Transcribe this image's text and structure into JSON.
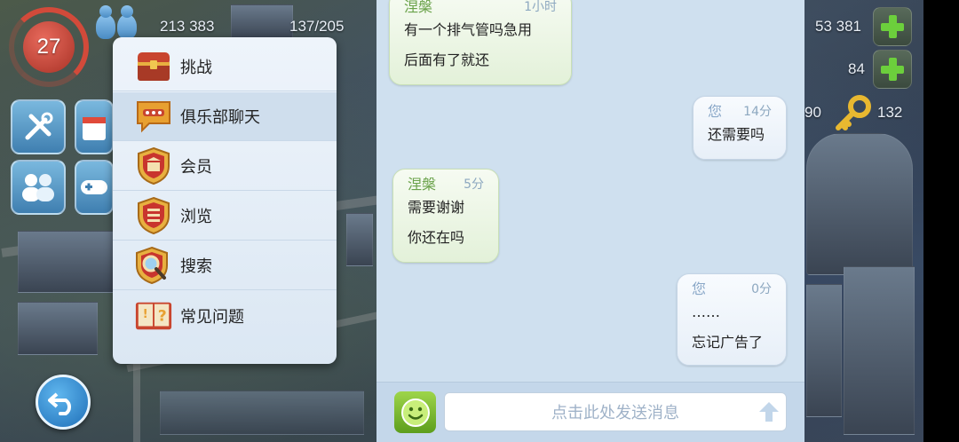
{
  "hud": {
    "level": "27",
    "population": "213 383",
    "capacity": "137/205",
    "simoleons": "53 381",
    "simcash": "84",
    "partial_value": "90",
    "keys": "132"
  },
  "menu": {
    "items": [
      {
        "label": "挑战",
        "icon": "treasure-chest-icon"
      },
      {
        "label": "俱乐部聊天",
        "icon": "chat-bubble-icon"
      },
      {
        "label": "会员",
        "icon": "building-shield-icon"
      },
      {
        "label": "浏览",
        "icon": "list-shield-icon"
      },
      {
        "label": "搜索",
        "icon": "magnifier-shield-icon"
      },
      {
        "label": "常见问题",
        "icon": "faq-book-icon"
      }
    ],
    "active_index": 1
  },
  "chat": {
    "messages": [
      {
        "from": "涅槃",
        "time": "1小时",
        "lines": [
          "有一个排气管吗急用",
          "后面有了就还"
        ],
        "direction": "in"
      },
      {
        "from": "您",
        "time": "14分",
        "lines": [
          "还需要吗"
        ],
        "direction": "out"
      },
      {
        "from": "涅槃",
        "time": "5分",
        "lines": [
          "需要谢谢",
          "你还在吗"
        ],
        "direction": "in"
      },
      {
        "from": "您",
        "time": "0分",
        "lines": [
          "……",
          "忘记广告了"
        ],
        "direction": "out"
      }
    ],
    "input_placeholder": "点击此处发送消息"
  },
  "colors": {
    "accent_green": "#6ccf3c",
    "chat_bg": "#cfe0ef",
    "level_red": "#d24a3a"
  }
}
